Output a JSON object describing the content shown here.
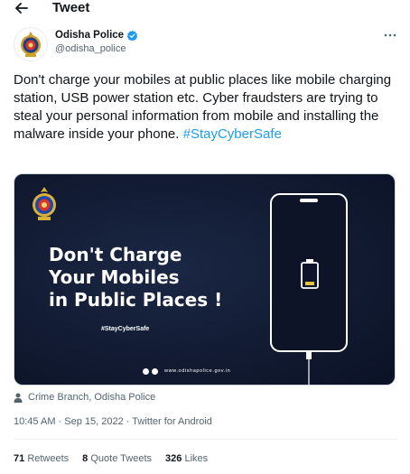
{
  "header": {
    "title": "Tweet",
    "back_icon": "arrow-left-icon"
  },
  "author": {
    "name": "Odisha Police",
    "handle": "@odisha_police",
    "verified": true,
    "avatar_icon": "police-emblem-icon"
  },
  "tweet": {
    "text": "Don't charge your mobiles at public places like mobile charging station, USB power station etc. Cyber fraudsters are trying to steal your personal information from mobile and installing the malware inside your phone. ",
    "hashtag": "#StayCyberSafe"
  },
  "media": {
    "headline_lines": [
      "Don't Charge",
      "Your Mobiles",
      "in Public Places !"
    ],
    "tag": "#StayCyberSafe",
    "website": "www.odishapolice.gov.in",
    "background_color": "#121b33"
  },
  "location": "Crime Branch, Odisha Police",
  "timestamp": "10:45 AM · Sep 15, 2022 · Twitter for Android",
  "stats": {
    "retweets_count": "71",
    "retweets_label": "Retweets",
    "quotes_count": "8",
    "quotes_label": "Quote Tweets",
    "likes_count": "326",
    "likes_label": "Likes"
  },
  "colors": {
    "accent": "#1d9bf0",
    "text_primary": "#0f1419",
    "text_secondary": "#536471"
  }
}
